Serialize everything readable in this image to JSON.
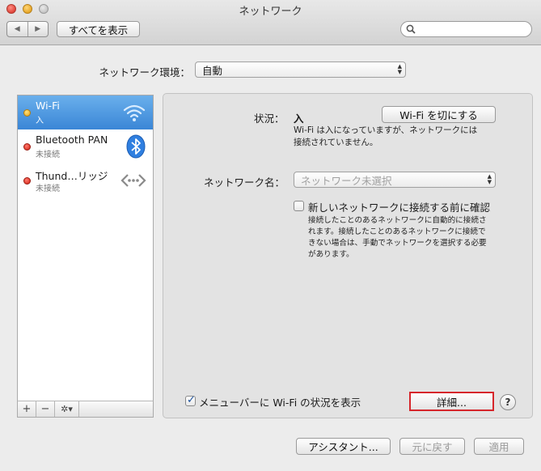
{
  "window": {
    "title": "ネットワーク"
  },
  "toolbar": {
    "back_glyph": "◀",
    "forward_glyph": "▶",
    "show_all_label": "すべてを表示",
    "search_placeholder": ""
  },
  "location": {
    "label": "ネットワーク環境：",
    "value": "自動"
  },
  "services": [
    {
      "name": "Wi-Fi",
      "status": "入",
      "status_color": "#f0b429",
      "icon": "wifi-icon",
      "selected": true
    },
    {
      "name": "Bluetooth PAN",
      "status": "未接続",
      "status_color": "#d21f12",
      "icon": "bluetooth-icon",
      "selected": false
    },
    {
      "name": "Thund…リッジ",
      "status": "未接続",
      "status_color": "#d21f12",
      "icon": "thunderbolt-bridge-icon",
      "selected": false
    }
  ],
  "sidebar_buttons": {
    "add": "+",
    "remove": "−",
    "action": "✲▾"
  },
  "detail": {
    "status_label": "状況：",
    "status_value": "入",
    "toggle_wifi_button": "Wi-Fi を切にする",
    "status_desc_1": "Wi-Fi は入になっていますが、ネットワークには",
    "status_desc_2": "接続されていません。",
    "network_name_label": "ネットワーク名：",
    "network_name_value": "ネットワーク未選択",
    "ask_join_label": "新しいネットワークに接続する前に確認",
    "ask_join_checked": false,
    "ask_join_desc_1": "接続したことのあるネットワークに自動的に接続さ",
    "ask_join_desc_2": "れます。接続したことのあるネットワークに接続で",
    "ask_join_desc_3": "きない場合は、手動でネットワークを選択する必要",
    "ask_join_desc_4": "があります。",
    "menubar_label": "メニューバーに Wi-Fi の状況を表示",
    "menubar_checked": true,
    "advanced_button": "詳細...",
    "help_button": "?"
  },
  "footer": {
    "assist": "アシスタント...",
    "revert": "元に戻す",
    "apply": "適用"
  },
  "colors": {
    "selection": "#3a86d6",
    "highlight_border": "#d6262b"
  }
}
